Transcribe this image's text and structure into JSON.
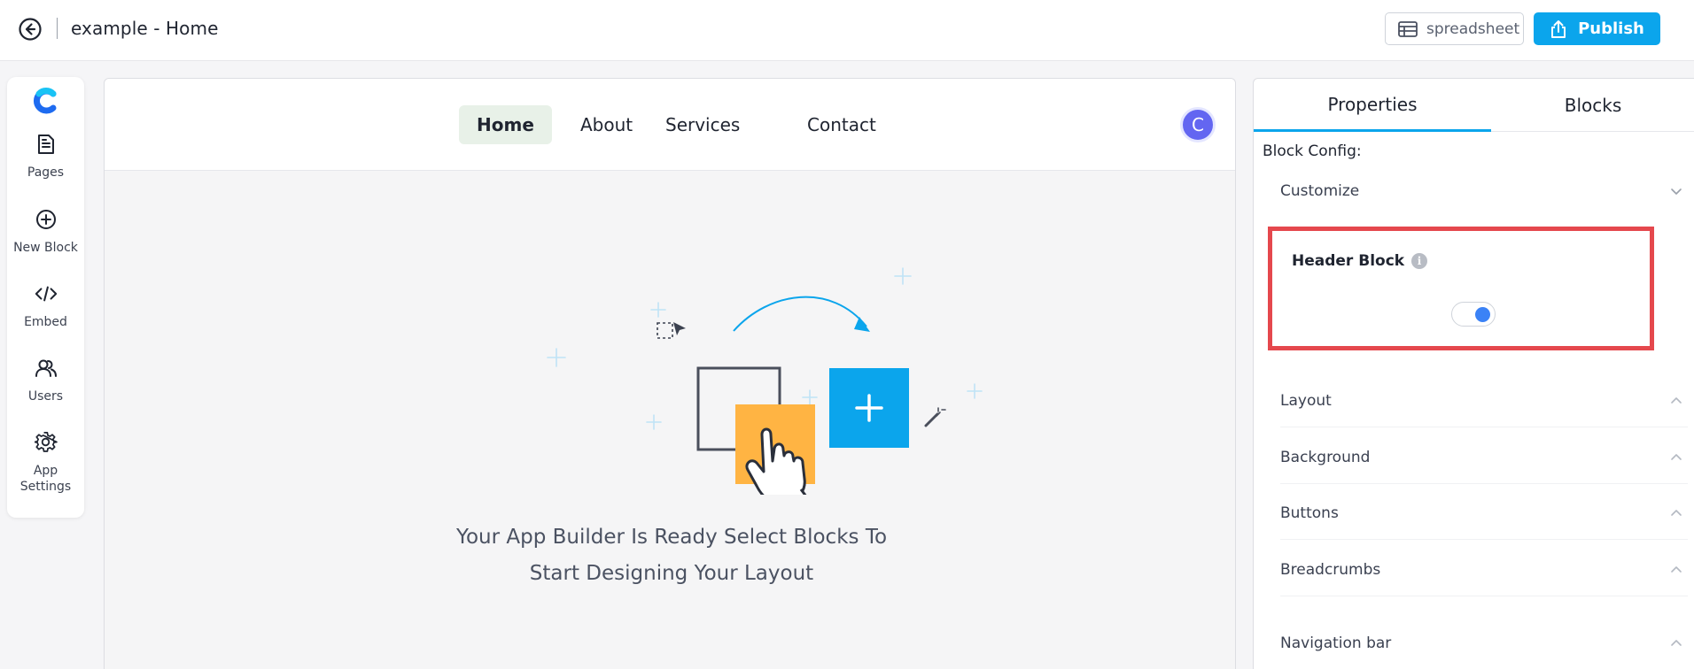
{
  "topbar": {
    "title": "example - Home",
    "spreadsheet_label": "spreadsheet",
    "publish_label": "Publish"
  },
  "rail": {
    "items": [
      {
        "label": "Pages",
        "icon": "pages-icon"
      },
      {
        "label": "New Block",
        "icon": "plus-circle-icon"
      },
      {
        "label": "Embed",
        "icon": "code-icon"
      },
      {
        "label": "Users",
        "icon": "users-icon"
      },
      {
        "label": "App Settings",
        "icon": "gear-icon"
      }
    ]
  },
  "canvas": {
    "nav": {
      "links": [
        "Home",
        "About",
        "Services",
        "Contact"
      ],
      "active": "Home",
      "avatar_initial": "C"
    },
    "empty_message_line1": "Your App Builder Is Ready Select Blocks To",
    "empty_message_line2": "Start Designing Your Layout"
  },
  "panel": {
    "tabs": [
      "Properties",
      "Blocks"
    ],
    "active_tab": "Properties",
    "block_config_label": "Block Config:",
    "customize_label": "Customize",
    "header_block": {
      "label": "Header Block",
      "toggle_on": true
    },
    "sections": [
      "Layout",
      "Background",
      "Buttons",
      "Breadcrumbs",
      "Navigation bar"
    ]
  },
  "colors": {
    "accent": "#0ba5ec",
    "highlight": "#e5484d",
    "avatar": "#6366f1",
    "toggle_knob": "#3b82f6",
    "active_nav_bg": "#e8f1e8"
  }
}
